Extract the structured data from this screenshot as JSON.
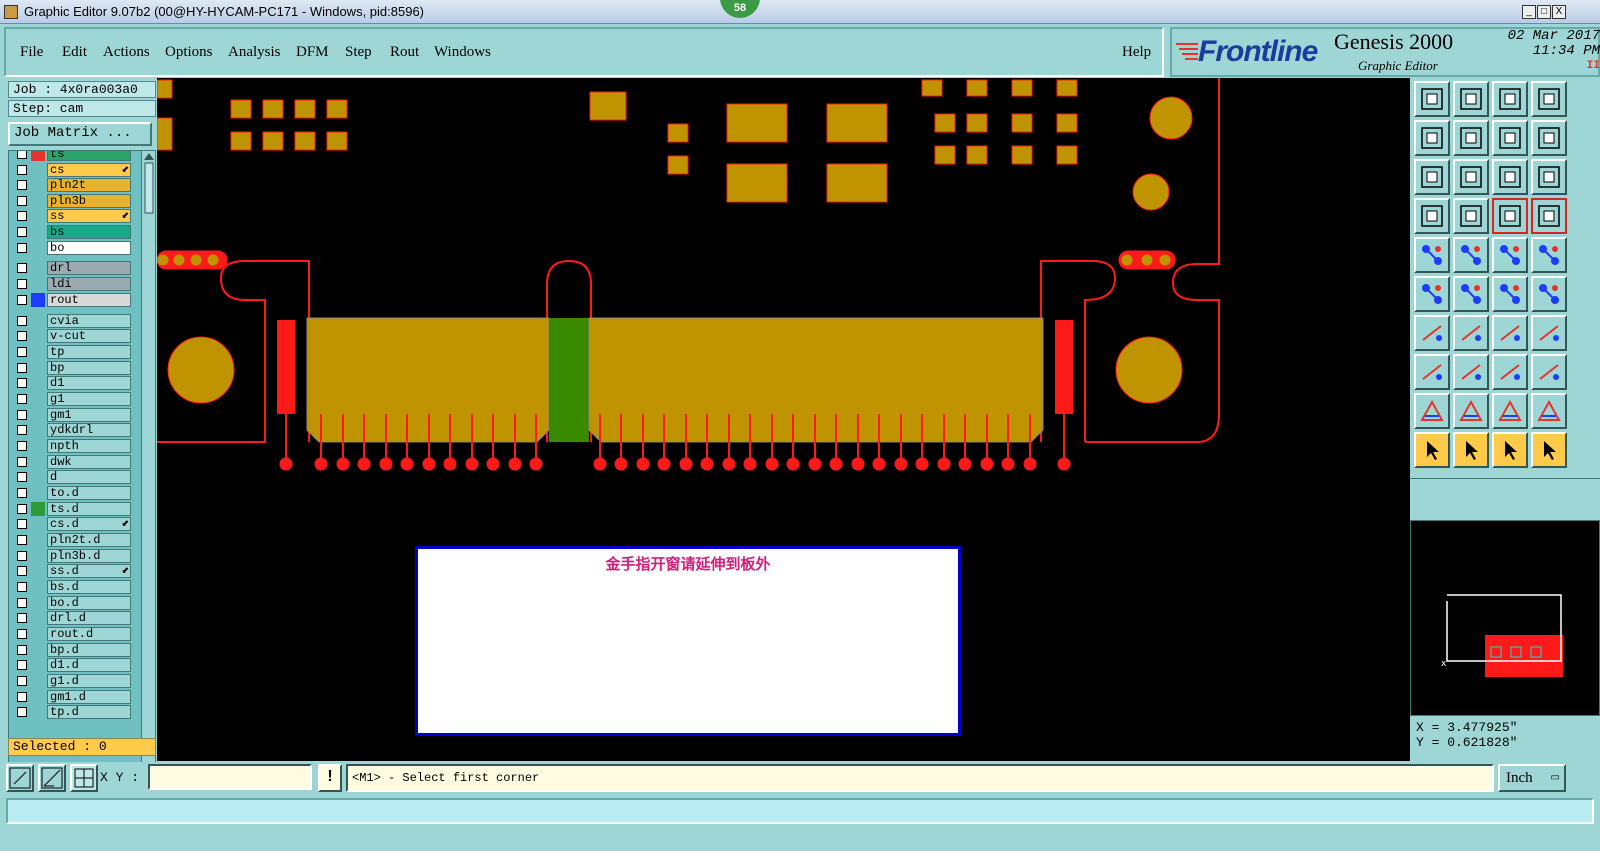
{
  "window": {
    "title": "Graphic Editor 9.07b2 (00@HY-HYCAM-PC171 - Windows, pid:8596)",
    "badge": "58",
    "minimize": "_",
    "restore": "□",
    "close": "X"
  },
  "menu": {
    "file": "File",
    "edit": "Edit",
    "actions": "Actions",
    "options": "Options",
    "analysis": "Analysis",
    "dfm": "DFM",
    "step": "Step",
    "rout": "Rout",
    "windows": "Windows",
    "help": "Help"
  },
  "brand": {
    "logo": "Frontline",
    "product": "Genesis 2000",
    "subtitle": "Graphic Editor",
    "date": "02 Mar 2017",
    "time": "11:34 PM",
    "indicator": "II"
  },
  "job": {
    "job_line": "Job : 4x0ra003a0",
    "step_line": "Step: cam",
    "matrix_button": "Job Matrix ..."
  },
  "layers": [
    {
      "name": "ts",
      "bg": "#2aa36b",
      "color": "#e8322c",
      "mark": ""
    },
    {
      "name": "cs",
      "bg": "#ffc94a",
      "color": "",
      "mark": "⬋"
    },
    {
      "name": "pln2t",
      "bg": "#e6b230",
      "color": "",
      "mark": ""
    },
    {
      "name": "pln3b",
      "bg": "#e6b230",
      "color": "",
      "mark": ""
    },
    {
      "name": "ss",
      "bg": "#ffc94a",
      "color": "",
      "mark": "⬋"
    },
    {
      "name": "bs",
      "bg": "#1aa88a",
      "color": "",
      "mark": ""
    },
    {
      "name": "bo",
      "bg": "#ffffff",
      "color": "",
      "mark": ""
    },
    {
      "name": "drl",
      "bg": "#9aaab0",
      "color": "",
      "mark": ""
    },
    {
      "name": "ldi",
      "bg": "#9aaab0",
      "color": "",
      "mark": ""
    },
    {
      "name": "rout",
      "bg": "#d8d8d8",
      "color": "#1c3cff",
      "mark": ""
    },
    {
      "name": "cvia",
      "bg": "#9ed6d6",
      "color": "",
      "mark": ""
    },
    {
      "name": "v-cut",
      "bg": "#9ed6d6",
      "color": "",
      "mark": ""
    },
    {
      "name": "tp",
      "bg": "#9ed6d6",
      "color": "",
      "mark": ""
    },
    {
      "name": "bp",
      "bg": "#9ed6d6",
      "color": "",
      "mark": ""
    },
    {
      "name": "d1",
      "bg": "#9ed6d6",
      "color": "",
      "mark": ""
    },
    {
      "name": "g1",
      "bg": "#9ed6d6",
      "color": "",
      "mark": ""
    },
    {
      "name": "gm1",
      "bg": "#9ed6d6",
      "color": "",
      "mark": ""
    },
    {
      "name": "ydkdrl",
      "bg": "#9ed6d6",
      "color": "",
      "mark": ""
    },
    {
      "name": "npth",
      "bg": "#9ed6d6",
      "color": "",
      "mark": ""
    },
    {
      "name": "dwk",
      "bg": "#9ed6d6",
      "color": "",
      "mark": ""
    },
    {
      "name": "d",
      "bg": "#9ed6d6",
      "color": "",
      "mark": ""
    },
    {
      "name": "to.d",
      "bg": "#9ed6d6",
      "color": "",
      "mark": ""
    },
    {
      "name": "ts.d",
      "bg": "#9ed6d6",
      "color": "#2e9b3a",
      "mark": ""
    },
    {
      "name": "cs.d",
      "bg": "#9ed6d6",
      "color": "",
      "mark": "⬋"
    },
    {
      "name": "pln2t.d",
      "bg": "#9ed6d6",
      "color": "",
      "mark": ""
    },
    {
      "name": "pln3b.d",
      "bg": "#9ed6d6",
      "color": "",
      "mark": ""
    },
    {
      "name": "ss.d",
      "bg": "#9ed6d6",
      "color": "",
      "mark": "⬋"
    },
    {
      "name": "bs.d",
      "bg": "#9ed6d6",
      "color": "",
      "mark": ""
    },
    {
      "name": "bo.d",
      "bg": "#9ed6d6",
      "color": "",
      "mark": ""
    },
    {
      "name": "drl.d",
      "bg": "#9ed6d6",
      "color": "",
      "mark": ""
    },
    {
      "name": "rout.d",
      "bg": "#9ed6d6",
      "color": "",
      "mark": ""
    },
    {
      "name": "bp.d",
      "bg": "#9ed6d6",
      "color": "",
      "mark": ""
    },
    {
      "name": "d1.d",
      "bg": "#9ed6d6",
      "color": "",
      "mark": ""
    },
    {
      "name": "g1.d",
      "bg": "#9ed6d6",
      "color": "",
      "mark": ""
    },
    {
      "name": "gm1.d",
      "bg": "#9ed6d6",
      "color": "",
      "mark": ""
    },
    {
      "name": "tp.d",
      "bg": "#9ed6d6",
      "color": "",
      "mark": ""
    }
  ],
  "selected": "Selected : 0",
  "canvas": {
    "note": "金手指开窗请延伸到板外",
    "colors": {
      "copper": "#c09400",
      "trace": "#ff1a1a",
      "mask": "#3a8a00",
      "background": "#000000"
    }
  },
  "coords": {
    "x": "X = 3.477925\"",
    "y": "Y = 0.621828\""
  },
  "bottom": {
    "xy_label": "X Y :",
    "xy_value": "",
    "warn": "!",
    "prompt": "<M1> - Select first corner",
    "units": "Inch"
  }
}
